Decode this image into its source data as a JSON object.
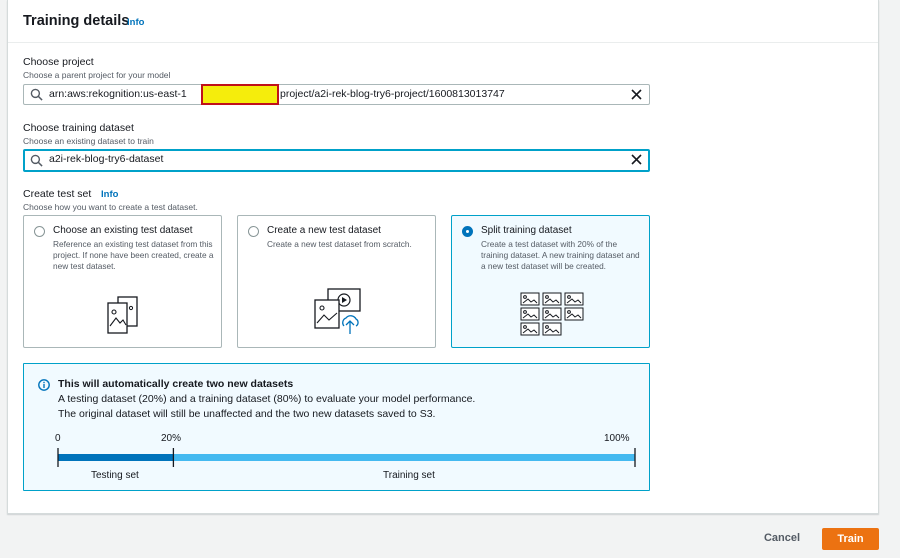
{
  "panel": {
    "title": "Training details",
    "info": "Info"
  },
  "project": {
    "label": "Choose project",
    "description": "Choose a parent project for your model",
    "value_prefix": "arn:aws:rekognition:us-east-1",
    "value_suffix": "project/a2i-rek-blog-try6-project/1600813013747"
  },
  "dataset": {
    "label": "Choose training dataset",
    "description": "Choose an existing dataset to train",
    "value": "a2i-rek-blog-try6-dataset"
  },
  "test_set": {
    "label": "Create test set",
    "info": "Info",
    "description": "Choose how you want to create a test dataset.",
    "options": [
      {
        "title": "Choose an existing test dataset",
        "description": "Reference an existing test dataset from this project. If none have been created, create a new test dataset.",
        "selected": false,
        "icon": "documents-icon"
      },
      {
        "title": "Create a new test dataset",
        "description": "Create a new test dataset from scratch.",
        "selected": false,
        "icon": "upload-media-icon"
      },
      {
        "title": "Split training dataset",
        "description": "Create a test dataset with 20% of the training dataset. A new training dataset and a new test dataset will be created.",
        "selected": true,
        "icon": "image-grid-icon"
      }
    ]
  },
  "alert": {
    "title": "This will automatically create two new datasets",
    "line1": "A testing dataset (20%) and a training dataset (80%) to evaluate your model performance.",
    "line2": "The original dataset will still be unaffected and the two new datasets saved to S3.",
    "split": {
      "ticks": [
        "0",
        "20%",
        "100%"
      ],
      "testing_fraction": 0.2,
      "testing_label": "Testing set",
      "training_label": "Training set",
      "testing_color": "#0073bb",
      "training_color": "#44b9f0"
    }
  },
  "footer": {
    "cancel": "Cancel",
    "train": "Train"
  },
  "colors": {
    "accent": "#0073bb",
    "primary_button": "#ec7211",
    "focus": "#00a1c9"
  }
}
